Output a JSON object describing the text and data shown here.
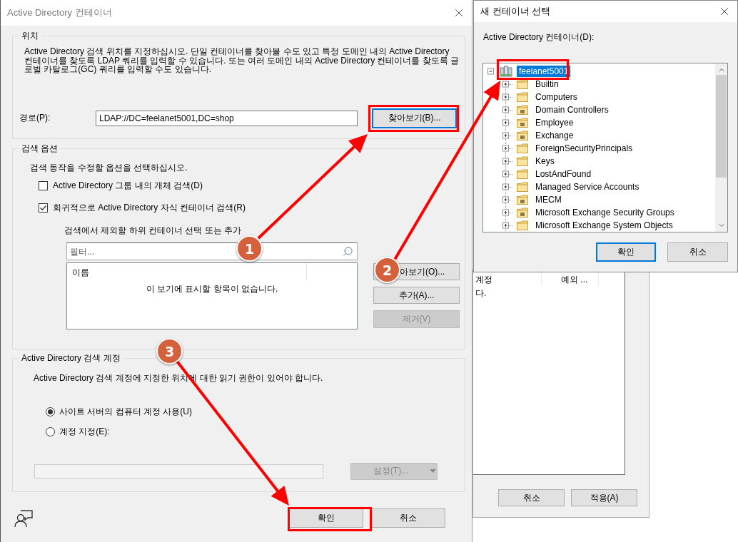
{
  "main_window": {
    "title": "Active Directory 컨테이너"
  },
  "location_group": {
    "legend": "위치",
    "description": "Active Directory 검색 위치를 지정하십시오. 단일 컨테이너를 찾아볼 수도 있고 특정 도메인 내의 Active Directory 컨테이너를 찾도록 LDAP 쿼리를 입력할 수 있습니다. 또는 여러 도메인 내의 Active Directory 컨테이너를 찾도록 글로벌 카탈로그(GC) 쿼리를 입력할 수도 있습니다.",
    "path_label": "경로(P):",
    "path_value": "LDAP://DC=feelanet5001,DC=shop",
    "browse_button": {
      "label": "찾아보기(B)...",
      "focused": true
    }
  },
  "search_options_group": {
    "legend": "검색 옵션",
    "instruction": "검색 동작을 수정할 옵션을 선택하십시오.",
    "checkboxes": [
      {
        "label": "Active Directory 그룹 내의 개체 검색(D)",
        "checked": false
      },
      {
        "label": "회귀적으로 Active Directory 자식 컨테이너 검색(R)",
        "checked": true
      }
    ],
    "exclude_label": "검색에서 제외할 하위 컨테이너 선택 또는 추가",
    "filter": {
      "placeholder": "필터..."
    },
    "list": {
      "columns": [
        "이름"
      ],
      "empty_message": "이 보기에 표시할 항목이 없습니다."
    },
    "buttons": [
      {
        "label": "아보기(O)...",
        "disabled": false
      },
      {
        "label": "추가(A)...",
        "disabled": false
      },
      {
        "label": "제거(V)",
        "disabled": true
      }
    ]
  },
  "account_group": {
    "legend": "Active Directory 검색 계정",
    "note": "Active Directory 검색 계정에 지정한 위치에 대한 읽기 권한이 있어야 합니다.",
    "radios": [
      {
        "label": "사이트 서버의 컴퓨터 계정 사용(U)",
        "selected": true
      },
      {
        "label": "계정 지정(E):",
        "selected": false
      }
    ],
    "account_field": {
      "disabled": true
    },
    "set_button": {
      "label": "설정(T)...",
      "disabled": true
    }
  },
  "footer_buttons": [
    {
      "label": "확인",
      "focused": false
    },
    {
      "label": "취소",
      "focused": false
    }
  ],
  "container_dialog": {
    "title": "새 컨테이너 선택",
    "tree_label": "Active Directory 컨테이너(D):",
    "tree": [
      {
        "label": "feelanet5001",
        "kind": "domain",
        "expanded": true,
        "selected": true,
        "children": [
          {
            "label": "Builtin",
            "kind": "container",
            "expanded": false,
            "selected": false
          },
          {
            "label": "Computers",
            "kind": "container",
            "expanded": false,
            "selected": false
          },
          {
            "label": "Domain Controllers",
            "kind": "ou",
            "expanded": false,
            "selected": false
          },
          {
            "label": "Employee",
            "kind": "ou",
            "expanded": false,
            "selected": false
          },
          {
            "label": "Exchange",
            "kind": "ou",
            "expanded": false,
            "selected": false
          },
          {
            "label": "ForeignSecurityPrincipals",
            "kind": "container",
            "expanded": false,
            "selected": false
          },
          {
            "label": "Keys",
            "kind": "container",
            "expanded": false,
            "selected": false
          },
          {
            "label": "LostAndFound",
            "kind": "container",
            "expanded": false,
            "selected": false
          },
          {
            "label": "Managed Service Accounts",
            "kind": "container",
            "expanded": false,
            "selected": false
          },
          {
            "label": "MECM",
            "kind": "ou",
            "expanded": false,
            "selected": false
          },
          {
            "label": "Microsoft Exchange Security Groups",
            "kind": "ou",
            "expanded": false,
            "selected": false
          },
          {
            "label": "Microsoft Exchange System Objects",
            "kind": "container",
            "expanded": false,
            "selected": false
          }
        ]
      }
    ],
    "buttons": [
      {
        "label": "확인",
        "focused": true
      },
      {
        "label": "취소",
        "focused": false
      }
    ]
  },
  "background_window": {
    "columns": [
      "계정",
      "예외 ..."
    ],
    "message": "다.",
    "buttons": [
      "취소",
      "적용(A)"
    ]
  },
  "annotations": {
    "steps": [
      {
        "number": "1"
      },
      {
        "number": "2"
      },
      {
        "number": "3"
      }
    ]
  }
}
